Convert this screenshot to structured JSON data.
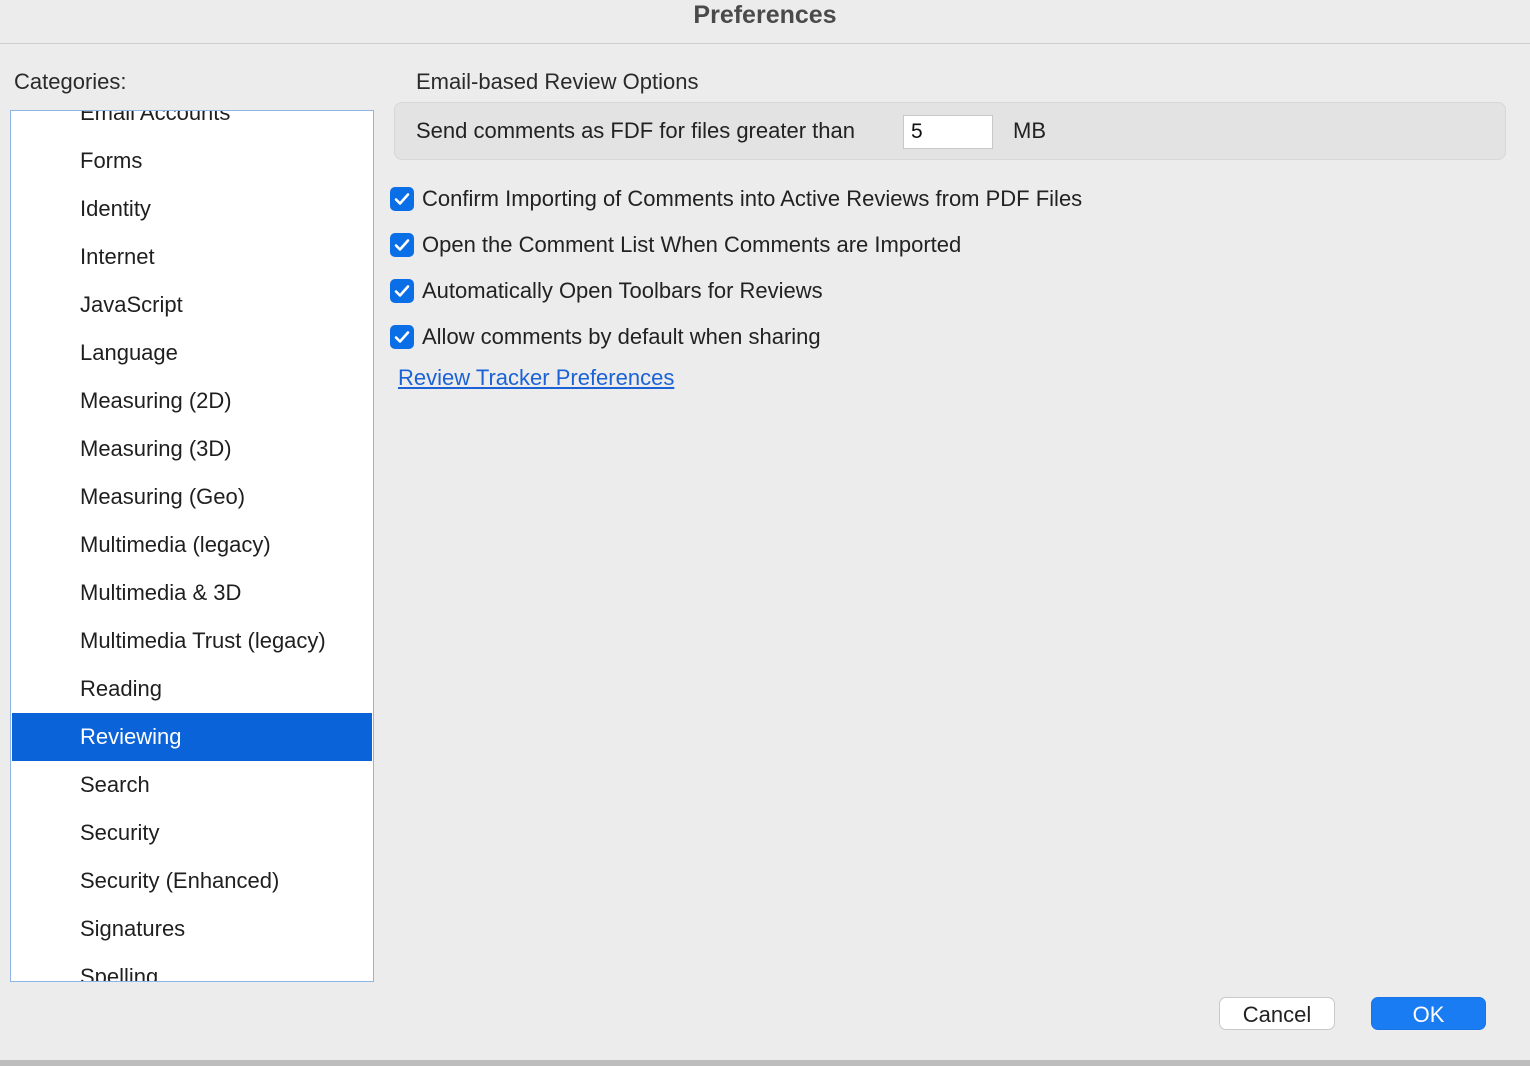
{
  "window": {
    "title": "Preferences"
  },
  "sidebar": {
    "label": "Categories:",
    "items": [
      {
        "label": "Email Accounts",
        "selected": false
      },
      {
        "label": "Forms",
        "selected": false
      },
      {
        "label": "Identity",
        "selected": false
      },
      {
        "label": "Internet",
        "selected": false
      },
      {
        "label": "JavaScript",
        "selected": false
      },
      {
        "label": "Language",
        "selected": false
      },
      {
        "label": "Measuring (2D)",
        "selected": false
      },
      {
        "label": "Measuring (3D)",
        "selected": false
      },
      {
        "label": "Measuring (Geo)",
        "selected": false
      },
      {
        "label": "Multimedia (legacy)",
        "selected": false
      },
      {
        "label": "Multimedia & 3D",
        "selected": false
      },
      {
        "label": "Multimedia Trust (legacy)",
        "selected": false
      },
      {
        "label": "Reading",
        "selected": false
      },
      {
        "label": "Reviewing",
        "selected": true
      },
      {
        "label": "Search",
        "selected": false
      },
      {
        "label": "Security",
        "selected": false
      },
      {
        "label": "Security (Enhanced)",
        "selected": false
      },
      {
        "label": "Signatures",
        "selected": false
      },
      {
        "label": "Spelling",
        "selected": false
      }
    ]
  },
  "main": {
    "section_title": "Email-based Review Options",
    "email": {
      "label": "Send comments as FDF for files greater than",
      "value": "5",
      "unit": "MB"
    },
    "checkboxes": [
      {
        "label": "Confirm Importing of Comments into Active Reviews from PDF Files",
        "checked": true
      },
      {
        "label": "Open the Comment List When Comments are Imported",
        "checked": true
      },
      {
        "label": "Automatically Open Toolbars for Reviews",
        "checked": true
      },
      {
        "label": "Allow comments by default when sharing",
        "checked": true
      }
    ],
    "link_label": "Review Tracker Preferences"
  },
  "footer": {
    "cancel_label": "Cancel",
    "ok_label": "OK"
  },
  "colors": {
    "accent": "#0a63d8",
    "link": "#1a62d6",
    "ok_button": "#1a7cf2"
  }
}
